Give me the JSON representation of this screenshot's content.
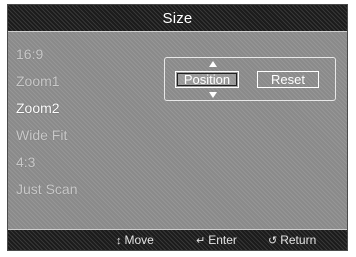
{
  "window": {
    "title": "Size"
  },
  "menu": {
    "items": [
      {
        "label": "16:9"
      },
      {
        "label": "Zoom1"
      },
      {
        "label": "Zoom2"
      },
      {
        "label": "Wide Fit"
      },
      {
        "label": "4:3"
      },
      {
        "label": "Just Scan"
      }
    ],
    "active_item": "Zoom2"
  },
  "submenu": {
    "position_label": "Position",
    "reset_label": "Reset",
    "selected": "Position"
  },
  "footer": {
    "move_icon": "↕",
    "move_label": "Move",
    "enter_icon": "↵",
    "enter_label": "Enter",
    "return_icon": "↺",
    "return_label": "Return"
  },
  "icons": {
    "move": "up-down-arrow-icon",
    "enter": "enter-icon",
    "return": "return-icon"
  }
}
